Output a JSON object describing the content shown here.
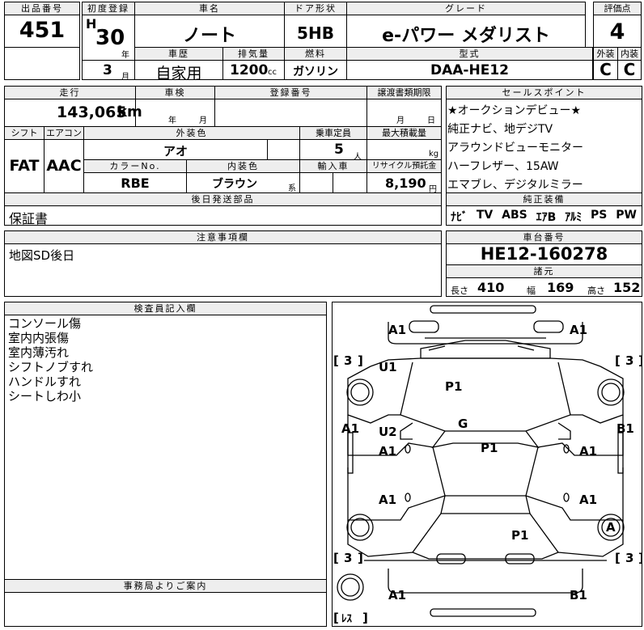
{
  "header": {
    "lot_label": "出品番号",
    "lot_number": "451",
    "first_reg_label": "初度登録",
    "era": "H",
    "reg_year": "30",
    "year_unit": "年",
    "reg_month": "3",
    "month_unit": "月",
    "car_name_label": "車名",
    "car_name": "ノート",
    "door_label": "ドア形状",
    "door_type": "5HB",
    "grade_label": "グレード",
    "grade": "e-パワー メダリスト",
    "score_label": "評価点",
    "score": "4",
    "history_label": "車歴",
    "history": "自家用",
    "displacement_label": "排気量",
    "displacement": "1200",
    "displacement_unit": "cc",
    "fuel_label": "燃料",
    "fuel": "ガソリン",
    "model_label": "型式",
    "model": "DAA-HE12",
    "exterior_label": "外装",
    "exterior_grade": "C",
    "interior_label": "内装",
    "interior_grade": "C"
  },
  "row2": {
    "mileage_label": "走行",
    "mileage": "143,065",
    "mileage_unit": "km",
    "inspection_label": "車検",
    "inspection_year_unit": "年",
    "inspection_month_unit": "月",
    "reg_number_label": "登録番号",
    "transfer_label": "譲渡書類期限",
    "transfer_month_unit": "月",
    "transfer_day_unit": "日",
    "shift_label": "シフト",
    "shift": "FAT",
    "aircon_label": "エアコン",
    "aircon": "AAC",
    "ext_color_label": "外装色",
    "ext_color": "アオ",
    "capacity_label": "乗車定員",
    "capacity": "5",
    "capacity_unit": "人",
    "max_load_label": "最大積載量",
    "max_load_unit": "kg",
    "color_no_label": "カラーNo.",
    "color_no": "RBE",
    "int_color_label": "内装色",
    "int_color": "ブラウン",
    "int_color_unit": "系",
    "import_label": "輸入車",
    "recycle_label": "リサイクル預託金",
    "recycle_fee": "8,190",
    "recycle_unit": "円",
    "later_parts_label": "後日発送部品",
    "later_parts": "保証書"
  },
  "sales": {
    "label": "セールスポイント",
    "points": [
      "★オークションデビュー★",
      "純正ナビ、地デジTV",
      "アラウンドビューモニター",
      "ハーフレザー、15AW",
      "エマブレ、デジタルミラー"
    ]
  },
  "equipment": {
    "label": "純正装備",
    "items": [
      "ﾅﾋﾞ",
      "TV",
      "ABS",
      "ｴｱB",
      "ｱﾙﾐ",
      "PS",
      "PW"
    ]
  },
  "notice": {
    "label": "注意事項欄",
    "text": "地図SD後日"
  },
  "chassis": {
    "label": "車台番号",
    "number": "HE12-160278"
  },
  "specs": {
    "label": "諸元",
    "length_label": "長さ",
    "length": "410",
    "width_label": "幅",
    "width": "169",
    "height_label": "高さ",
    "height": "152"
  },
  "inspector": {
    "label": "検査員記入欄",
    "notes": [
      "コンソール傷",
      "室内内張傷",
      "室内薄汚れ",
      "シフトノブすれ",
      "ハンドルすれ",
      "シートしわ小"
    ]
  },
  "office": {
    "label": "事務局よりご案内"
  },
  "diagram": {
    "marks": {
      "front_left": "A1",
      "front_right": "A1",
      "hood_left": "U1",
      "hood_right": "P1",
      "left_front_fender": "A1",
      "right_front_fender": "B1",
      "windshield": "G",
      "roof": "P1",
      "left_front_door_upper": "U2",
      "left_front_door": "A1",
      "right_front_door": "A1",
      "left_rear_door": "A1",
      "right_rear_door": "A1",
      "rear_hatch": "P1",
      "right_rear_wheel": "A",
      "rear_left": "A1",
      "rear_right": "B1",
      "door_zero": "0"
    },
    "tire_tread": "3",
    "spare": "ﾚｽ",
    "bracket_open": "[",
    "bracket_close": "]"
  }
}
